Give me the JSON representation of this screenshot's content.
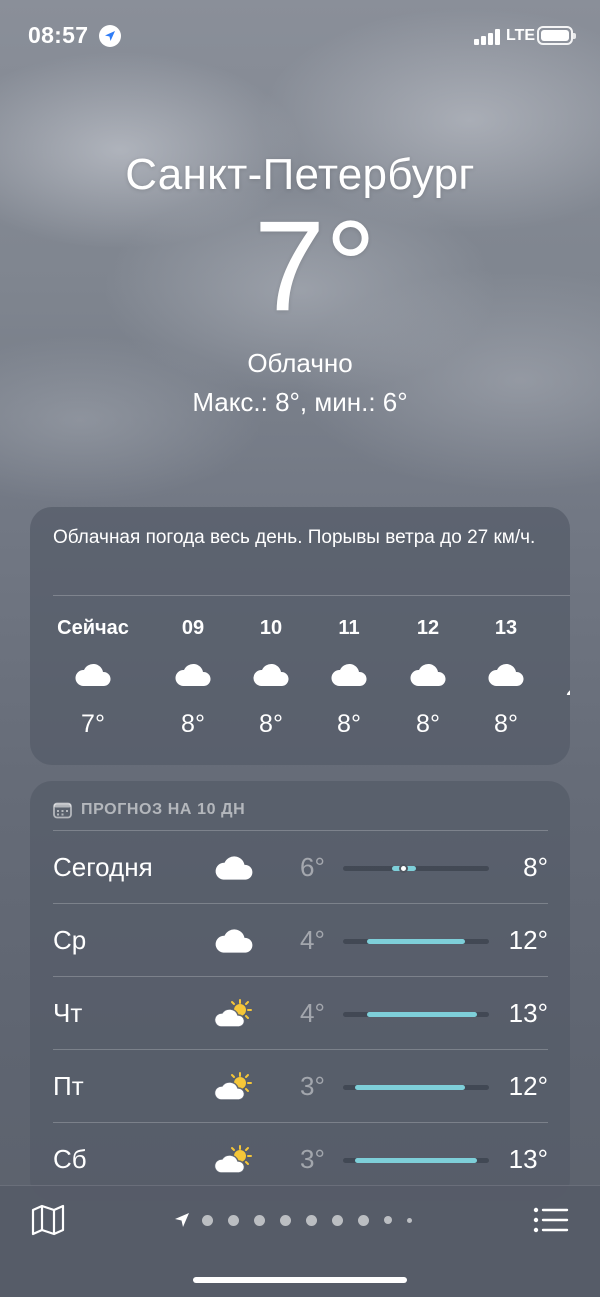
{
  "status_bar": {
    "time": "08:57",
    "network": "LTE"
  },
  "location": {
    "city": "Санкт-Петербург",
    "temperature": "7°",
    "condition": "Облачно",
    "hi_lo": "Макс.: 8°, мин.: 6°"
  },
  "hourly": {
    "summary": "Облачная погода весь день. Порывы ветра до 27 км/ч.",
    "items": [
      {
        "label": "Сейчас",
        "icon": "cloud-icon",
        "temp": "7°"
      },
      {
        "label": "09",
        "icon": "cloud-icon",
        "temp": "8°"
      },
      {
        "label": "10",
        "icon": "cloud-icon",
        "temp": "8°"
      },
      {
        "label": "11",
        "icon": "cloud-icon",
        "temp": "8°"
      },
      {
        "label": "12",
        "icon": "cloud-icon",
        "temp": "8°"
      },
      {
        "label": "13",
        "icon": "cloud-icon",
        "temp": "8°"
      }
    ]
  },
  "daily": {
    "header": "ПРОГНОЗ НА 10 ДН",
    "days": [
      {
        "name": "Сегодня",
        "icon": "cloud-icon",
        "low": "6°",
        "high": "8°",
        "range": [
          6,
          8
        ],
        "current": 7
      },
      {
        "name": "Ср",
        "icon": "cloud-icon",
        "low": "4°",
        "high": "12°",
        "range": [
          4,
          12
        ]
      },
      {
        "name": "Чт",
        "icon": "partly-sunny-icon",
        "low": "4°",
        "high": "13°",
        "range": [
          4,
          13
        ]
      },
      {
        "name": "Пт",
        "icon": "partly-sunny-icon",
        "low": "3°",
        "high": "12°",
        "range": [
          3,
          12
        ]
      },
      {
        "name": "Сб",
        "icon": "partly-sunny-icon",
        "low": "3°",
        "high": "13°",
        "range": [
          3,
          13
        ]
      }
    ],
    "scale": [
      2,
      14
    ]
  },
  "bottom_bar": {
    "pages": 8,
    "active_page": "current-location"
  },
  "colors": {
    "temp_bar": "#7ecfd9",
    "sun": "#f5c638"
  }
}
